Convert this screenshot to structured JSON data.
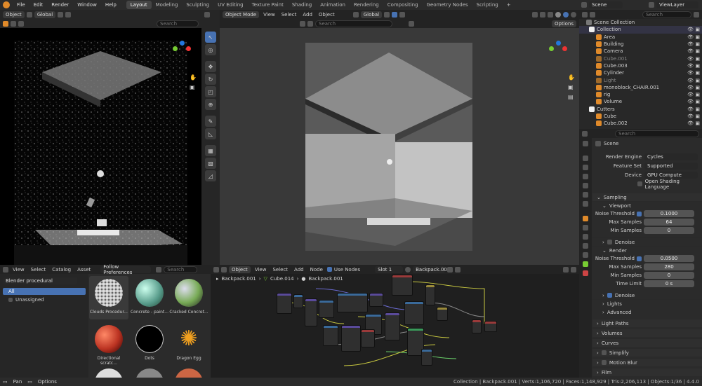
{
  "app": {
    "menu": [
      "File",
      "Edit",
      "Render",
      "Window",
      "Help"
    ],
    "workspaces": [
      "Layout",
      "Modeling",
      "Sculpting",
      "UV Editing",
      "Texture Paint",
      "Shading",
      "Animation",
      "Rendering",
      "Compositing",
      "Geometry Nodes",
      "Scripting"
    ],
    "active_workspace": "Layout",
    "plus": "+",
    "scene": "Scene",
    "view_layer": "ViewLayer"
  },
  "left_viewport": {
    "mode": "Object",
    "orientation": "Global",
    "search_placeholder": "Search"
  },
  "main_viewport": {
    "mode": "Object Mode",
    "menus": [
      "View",
      "Select",
      "Add",
      "Object"
    ],
    "orientation": "Global",
    "search_placeholder": "Search",
    "options": "Options"
  },
  "outliner": {
    "search_placeholder": "Search",
    "root": "Scene Collection",
    "items": [
      {
        "label": "Collection",
        "level": 0
      },
      {
        "label": "Area",
        "level": 1
      },
      {
        "label": "Building",
        "level": 1
      },
      {
        "label": "Camera",
        "level": 1
      },
      {
        "label": "Cube.001",
        "level": 1
      },
      {
        "label": "Cube.003",
        "level": 1
      },
      {
        "label": "Cylinder",
        "level": 1
      },
      {
        "label": "Light",
        "level": 1
      },
      {
        "label": "monoblock_CHAIR.001",
        "level": 1
      },
      {
        "label": "rig",
        "level": 1
      },
      {
        "label": "Volume",
        "level": 1
      },
      {
        "label": "Cutters",
        "level": 0
      },
      {
        "label": "Cube",
        "level": 1
      },
      {
        "label": "Cube.002",
        "level": 1
      }
    ]
  },
  "properties": {
    "search_placeholder": "Search",
    "scene": "Scene",
    "render_engine_label": "Render Engine",
    "render_engine": "Cycles",
    "feature_set_label": "Feature Set",
    "feature_set": "Supported",
    "device_label": "Device",
    "device": "GPU Compute",
    "osl": "Open Shading Language",
    "sampling": "Sampling",
    "viewport": "Viewport",
    "vp_noise_label": "Noise Threshold",
    "vp_noise": "0.1000",
    "vp_max_label": "Max Samples",
    "vp_max": "64",
    "vp_min_label": "Min Samples",
    "vp_min": "0",
    "denoise": "Denoise",
    "render": "Render",
    "r_noise_label": "Noise Threshold",
    "r_noise": "0.0500",
    "r_max_label": "Max Samples",
    "r_max": "280",
    "r_min_label": "Min Samples",
    "r_min": "0",
    "r_time_label": "Time Limit",
    "r_time": "0 s",
    "r_denoise": "Denoise",
    "lights": "Lights",
    "advanced": "Advanced",
    "sections": [
      "Light Paths",
      "Volumes",
      "Curves",
      "Simplify",
      "Motion Blur",
      "Film"
    ]
  },
  "asset_browser": {
    "menus": [
      "View",
      "Select",
      "Catalog",
      "Asset"
    ],
    "import": "Follow Preferences",
    "search_placeholder": "Search",
    "library": "Blender procedural",
    "all": "All",
    "unassigned": "Unassigned",
    "assets": [
      "Clouds Procedur...",
      "Concrete - paint...",
      "Cracked Concret...",
      "Directional scratc...",
      "Dots",
      "Dragon Egg"
    ]
  },
  "node_editor": {
    "type": "Object",
    "menus": [
      "View",
      "Select",
      "Add",
      "Node"
    ],
    "use_nodes": "Use Nodes",
    "slot": "Slot 1",
    "material": "Backpack.001",
    "breadcrumb": [
      "Backpack.001",
      "Cube.014",
      "Backpack.001"
    ]
  },
  "status": {
    "left": [
      "Pan",
      "Options"
    ],
    "right": "Collection | Backpack.001 | Verts:1,106,720 | Faces:1,148,929 | Tris:2,206,113 | Objects:1/36 | 4.4.0"
  },
  "colors": {
    "accent": "#4772b3",
    "orange": "#e08a2a",
    "x_axis": "#e33",
    "y_axis": "#7c3",
    "z_axis": "#27d"
  }
}
